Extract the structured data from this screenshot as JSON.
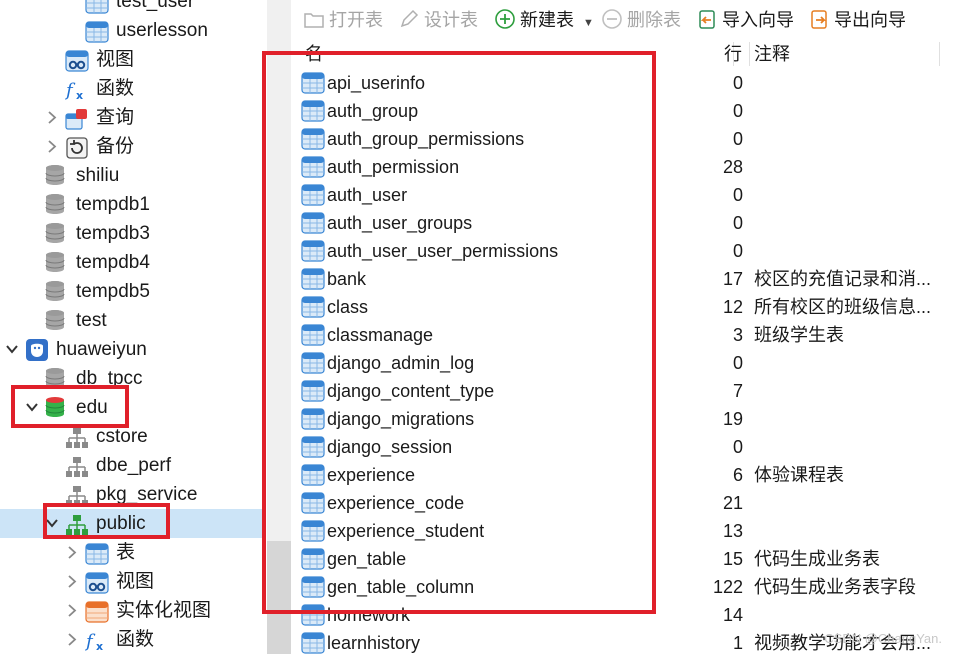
{
  "sidebar": {
    "items": [
      {
        "label": "test_user",
        "icon": "table-icon",
        "indent": 2,
        "chevron": ""
      },
      {
        "label": "userlesson",
        "icon": "table-icon",
        "indent": 2,
        "chevron": ""
      },
      {
        "label": "视图",
        "icon": "view-icon",
        "indent": 1,
        "chevron": ""
      },
      {
        "label": "函数",
        "icon": "function-icon",
        "indent": 1,
        "chevron": ""
      },
      {
        "label": "查询",
        "icon": "query-icon",
        "indent": 1,
        "chevron": "›"
      },
      {
        "label": "备份",
        "icon": "backup-icon",
        "indent": 1,
        "chevron": "›"
      },
      {
        "label": "shiliu",
        "icon": "database-icon",
        "indent": 0,
        "chevron": ""
      },
      {
        "label": "tempdb1",
        "icon": "database-icon",
        "indent": 0,
        "chevron": ""
      },
      {
        "label": "tempdb3",
        "icon": "database-icon",
        "indent": 0,
        "chevron": ""
      },
      {
        "label": "tempdb4",
        "icon": "database-icon",
        "indent": 0,
        "chevron": ""
      },
      {
        "label": "tempdb5",
        "icon": "database-icon",
        "indent": 0,
        "chevron": ""
      },
      {
        "label": "test",
        "icon": "database-icon",
        "indent": 0,
        "chevron": ""
      },
      {
        "label": "huaweiyun",
        "icon": "connection-icon",
        "indent": -1,
        "chevron": "⌄"
      },
      {
        "label": "db_tpcc",
        "icon": "database-icon",
        "indent": 0,
        "chevron": ""
      },
      {
        "label": "edu",
        "icon": "database-open-icon",
        "indent": 0,
        "chevron": "⌄"
      },
      {
        "label": "cstore",
        "icon": "schema-icon",
        "indent": 1,
        "chevron": ""
      },
      {
        "label": "dbe_perf",
        "icon": "schema-icon",
        "indent": 1,
        "chevron": ""
      },
      {
        "label": "pkg_service",
        "icon": "schema-icon",
        "indent": 1,
        "chevron": ""
      },
      {
        "label": "public",
        "icon": "schema-open-icon",
        "indent": 1,
        "chevron": "⌄"
      },
      {
        "label": "表",
        "icon": "table-icon",
        "indent": 2,
        "chevron": "›"
      },
      {
        "label": "视图",
        "icon": "view-icon",
        "indent": 2,
        "chevron": "›"
      },
      {
        "label": "实体化视图",
        "icon": "materialized-view-icon",
        "indent": 2,
        "chevron": "›"
      },
      {
        "label": "函数",
        "icon": "function-icon",
        "indent": 2,
        "chevron": "›"
      }
    ],
    "selected": "public"
  },
  "toolbar": {
    "open_table": "打开表",
    "design_table": "设计表",
    "new_table": "新建表",
    "delete_table": "删除表",
    "import_wizard": "导入向导",
    "export_wizard": "导出向导"
  },
  "table_list": {
    "columns": {
      "name": "名",
      "rows": "行",
      "comment": "注释"
    },
    "rows": [
      {
        "name": "api_userinfo",
        "rows": "0",
        "comment": ""
      },
      {
        "name": "auth_group",
        "rows": "0",
        "comment": ""
      },
      {
        "name": "auth_group_permissions",
        "rows": "0",
        "comment": ""
      },
      {
        "name": "auth_permission",
        "rows": "28",
        "comment": ""
      },
      {
        "name": "auth_user",
        "rows": "0",
        "comment": ""
      },
      {
        "name": "auth_user_groups",
        "rows": "0",
        "comment": ""
      },
      {
        "name": "auth_user_user_permissions",
        "rows": "0",
        "comment": ""
      },
      {
        "name": "bank",
        "rows": "17",
        "comment": "校区的充值记录和消..."
      },
      {
        "name": "class",
        "rows": "12",
        "comment": "所有校区的班级信息..."
      },
      {
        "name": "classmanage",
        "rows": "3",
        "comment": "班级学生表"
      },
      {
        "name": "django_admin_log",
        "rows": "0",
        "comment": ""
      },
      {
        "name": "django_content_type",
        "rows": "7",
        "comment": ""
      },
      {
        "name": "django_migrations",
        "rows": "19",
        "comment": ""
      },
      {
        "name": "django_session",
        "rows": "0",
        "comment": ""
      },
      {
        "name": "experience",
        "rows": "6",
        "comment": "体验课程表"
      },
      {
        "name": "experience_code",
        "rows": "21",
        "comment": ""
      },
      {
        "name": "experience_student",
        "rows": "13",
        "comment": ""
      },
      {
        "name": "gen_table",
        "rows": "15",
        "comment": "代码生成业务表"
      },
      {
        "name": "gen_table_column",
        "rows": "122",
        "comment": "代码生成业务表字段"
      },
      {
        "name": "homework",
        "rows": "14",
        "comment": ""
      },
      {
        "name": "learnhistory",
        "rows": "1",
        "comment": "视频教学功能才会用..."
      }
    ]
  },
  "watermark": "CSDN @ChangYan.",
  "colors": {
    "annotation_red": "#e0202a",
    "selection": "#cce4f7",
    "accent_green": "#2e9e3e"
  }
}
